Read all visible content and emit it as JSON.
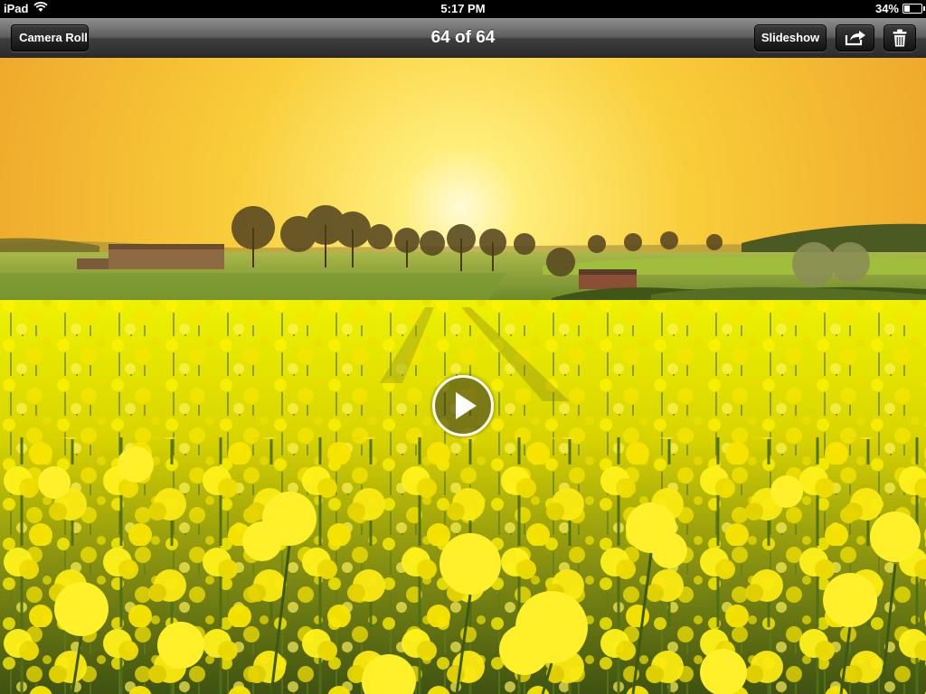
{
  "status_bar": {
    "device": "iPad",
    "time": "5:17 PM",
    "battery_percent": "34%",
    "battery_level": 0.34,
    "icons": [
      "wifi-icon",
      "battery-icon"
    ]
  },
  "nav_bar": {
    "back_label": "Camera Roll",
    "title": "64 of 64",
    "slideshow_label": "Slideshow",
    "icons": [
      "share-icon",
      "trash-icon"
    ]
  },
  "photo": {
    "overlay_icon": "play-icon"
  },
  "colors": {
    "sky_top": "#f0b12a",
    "sky_glow": "#fff6b0",
    "field_yellow": "#f3e600",
    "grass_green": "#8aa13a"
  }
}
